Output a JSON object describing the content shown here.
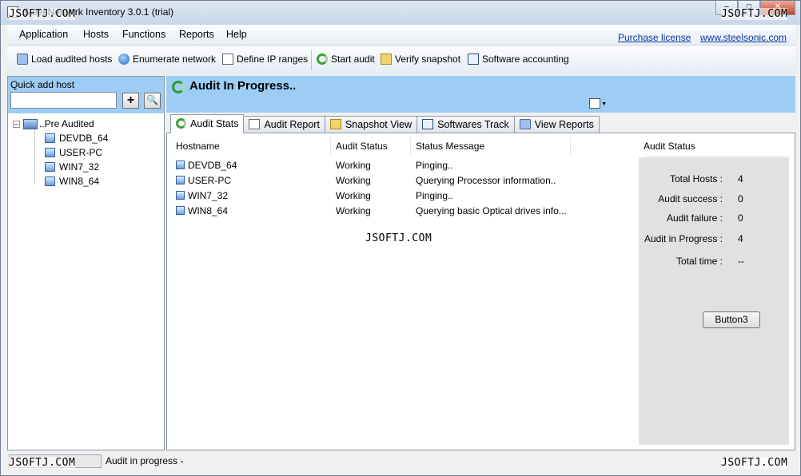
{
  "window": {
    "title": "Steel Network Inventory 3.0.1 (trial)"
  },
  "watermark": "JSOFTJ.COM",
  "menu": {
    "items": [
      "Application",
      "Hosts",
      "Functions",
      "Reports",
      "Help"
    ],
    "links": [
      "Purchase license",
      "www.steelsonic.com"
    ]
  },
  "toolbar": {
    "load_hosts": "Load audited hosts",
    "enumerate": "Enumerate network",
    "define_ip": "Define IP ranges",
    "start_audit": "Start audit",
    "verify": "Verify snapshot",
    "software": "Software accounting"
  },
  "quick_add": {
    "label": "Quick add host",
    "value": "",
    "add_symbol": "+"
  },
  "tree": {
    "root": "..Pre Audited",
    "hosts": [
      "DEVDB_64",
      "USER-PC",
      "WIN7_32",
      "WIN8_64"
    ]
  },
  "header": {
    "title": "Audit In Progress.."
  },
  "tabs": [
    "Audit Stats",
    "Audit Report",
    "Snapshot View",
    "Softwares Track",
    "View Reports"
  ],
  "table": {
    "columns": [
      "Hostname",
      "Audit Status",
      "Status Message"
    ],
    "rows": [
      {
        "host": "DEVDB_64",
        "status": "Working",
        "message": "Pinging.."
      },
      {
        "host": "USER-PC",
        "status": "Working",
        "message": "Querying Processor information.."
      },
      {
        "host": "WIN7_32",
        "status": "Working",
        "message": "Pinging.."
      },
      {
        "host": "WIN8_64",
        "status": "Working",
        "message": "Querying basic Optical drives info..."
      }
    ]
  },
  "audit_status": {
    "title": "Audit Status",
    "total_hosts_label": "Total Hosts :",
    "total_hosts": "4",
    "success_label": "Audit success :",
    "success": "0",
    "failure_label": "Audit failure :",
    "failure": "0",
    "in_progress_label": "Audit in Progress :",
    "in_progress": "4",
    "total_time_label": "Total time :",
    "total_time": "--",
    "button": "Button3"
  },
  "statusbar": {
    "text": "Audit in progress  -"
  }
}
